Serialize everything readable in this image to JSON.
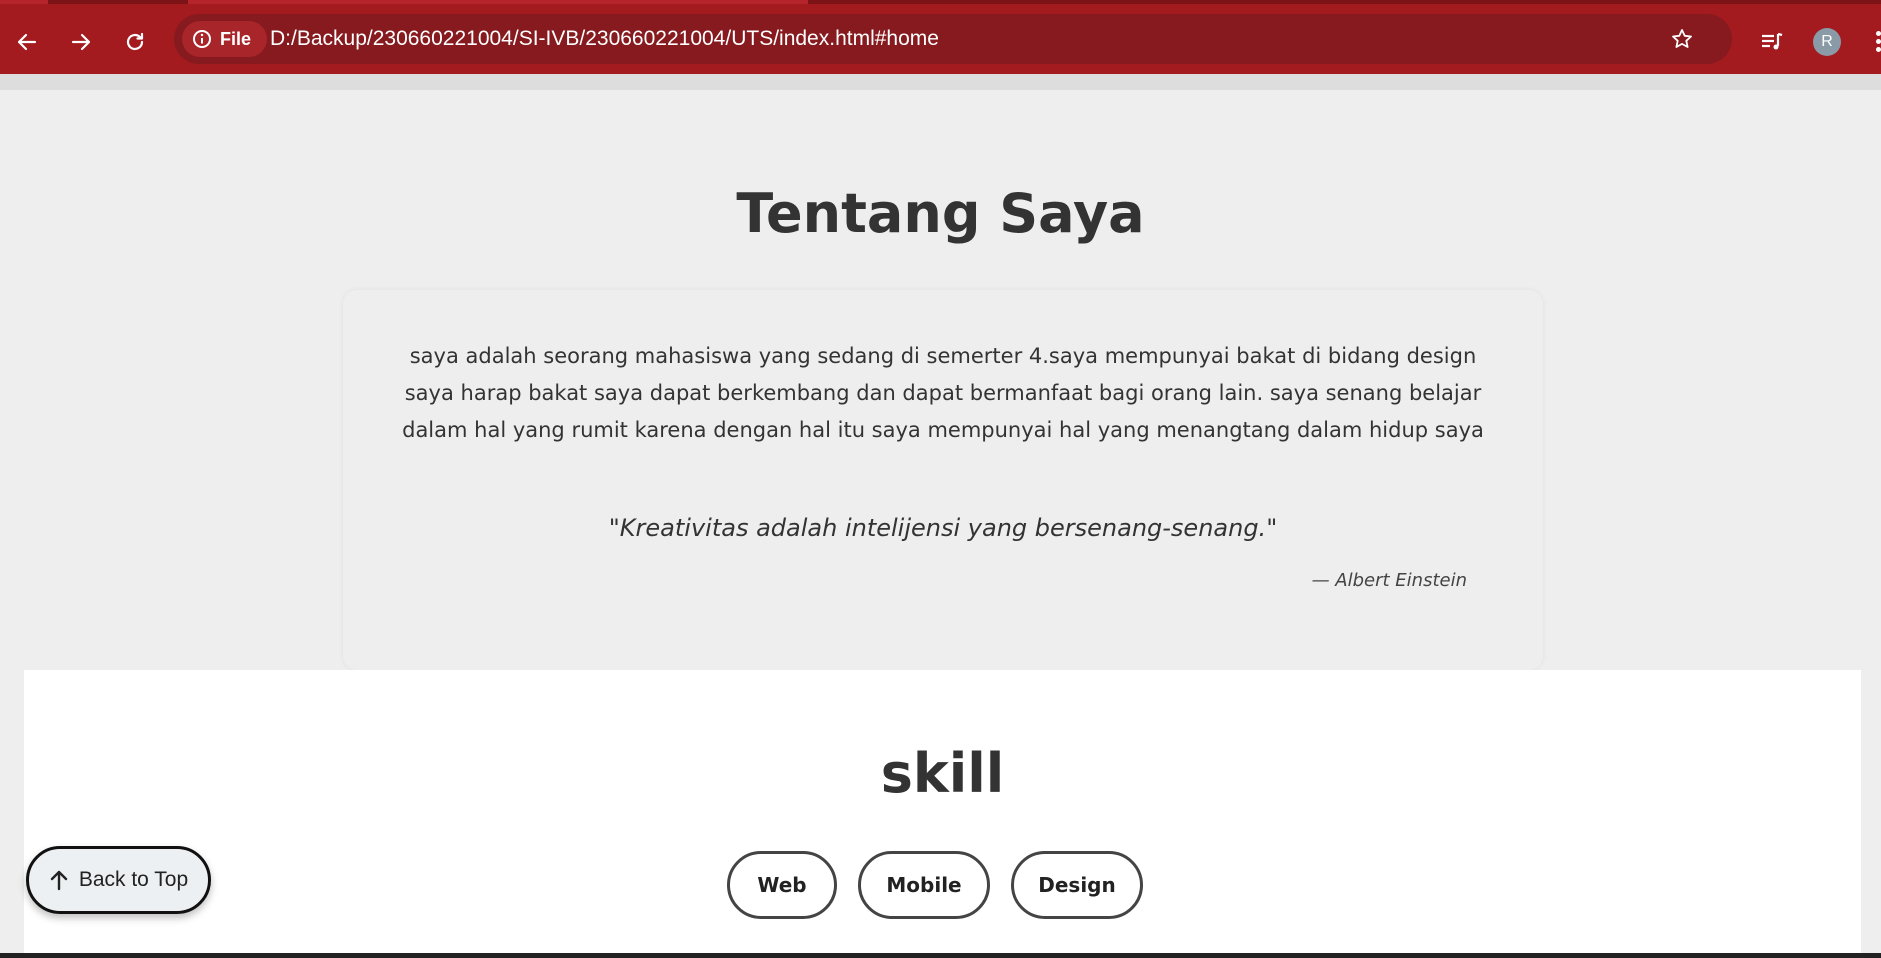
{
  "browser": {
    "site_chip_label": "File",
    "url": "D:/Backup/230660221004/SI-IVB/230660221004/UTS/index.html#home",
    "profile_initial": "R"
  },
  "about": {
    "title": "Tentang Saya",
    "paragraph": "saya adalah seorang mahasiswa yang sedang di semerter 4.saya mempunyai bakat di bidang design saya harap bakat saya dapat berkembang dan dapat bermanfaat bagi orang lain. saya senang belajar dalam hal yang rumit karena dengan hal itu saya mempunyai hal yang menangtang dalam hidup saya",
    "quote": "\"Kreativitas adalah intelijensi yang bersenang-senang.\"",
    "quote_author": "— Albert Einstein"
  },
  "skill": {
    "title": "skill",
    "buttons": [
      "Web",
      "Mobile",
      "Design"
    ]
  },
  "back_to_top_label": "Back to Top",
  "colors": {
    "chrome_red": "#a31a1f",
    "omnibox": "#861a1e",
    "page_bg": "#eeeeee",
    "text": "#333333"
  },
  "icons": {
    "back": "arrow-left-icon",
    "forward": "arrow-right-icon",
    "reload": "reload-icon",
    "site_info": "info-circle-icon",
    "bookmark": "star-icon",
    "media": "playlist-icon",
    "menu": "kebab-menu-icon",
    "back_to_top": "arrow-up-icon"
  }
}
